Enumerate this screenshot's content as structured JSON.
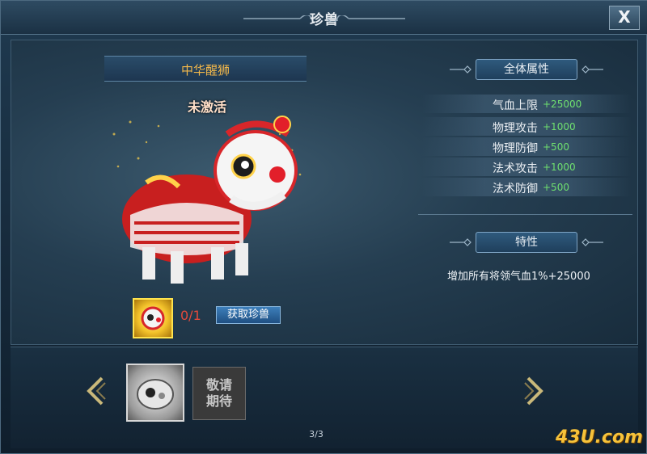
{
  "window": {
    "title": "珍兽",
    "close_label": "X"
  },
  "beast": {
    "name": "中华醒狮",
    "status": "未激活",
    "count": "0/1",
    "obtain_button": "获取珍兽"
  },
  "attributes": {
    "header": "全体属性",
    "rows": [
      {
        "label": "气血上限",
        "value": "+25000"
      },
      {
        "label": "物理攻击",
        "value": "+1000"
      },
      {
        "label": "物理防御",
        "value": "+500"
      },
      {
        "label": "法术攻击",
        "value": "+1000"
      },
      {
        "label": "法术防御",
        "value": "+500"
      }
    ]
  },
  "trait": {
    "header": "特性",
    "text": "增加所有将领气血1%+25000"
  },
  "carousel": {
    "coming_soon_line1": "敬请",
    "coming_soon_line2": "期待",
    "page": "3/3"
  },
  "watermark": "43U.com",
  "colors": {
    "name_gold": "#f3b84a",
    "value_green": "#6fe06f",
    "count_red": "#e24a3c",
    "button_blue": "#2e6aa3"
  }
}
